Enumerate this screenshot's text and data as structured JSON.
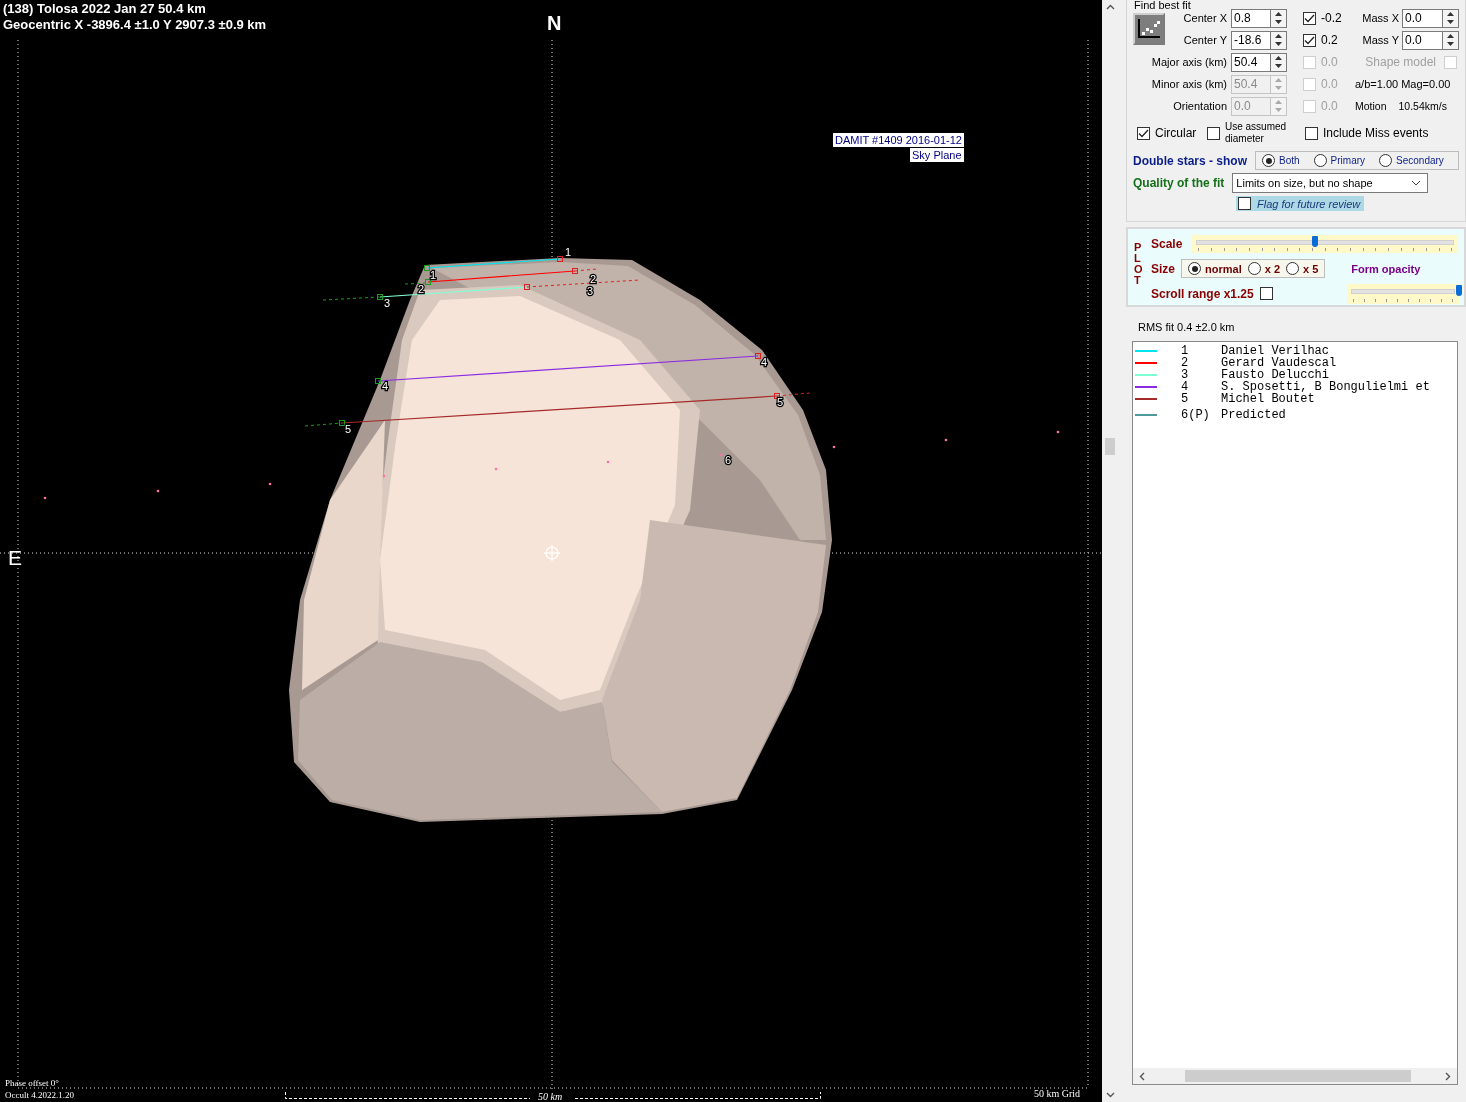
{
  "plot": {
    "title": "(138) Tolosa  2022 Jan 27   50.4 km",
    "subtitle": "Geocentric  X  -3896.4 ±1.0  Y 2907.3 ±0.9 km",
    "north": "N",
    "east": "E",
    "model_label": "DAMIT #1409 2016-01-12",
    "plane_label": "Sky Plane",
    "chords": [
      {
        "labels": [
          "1",
          "1"
        ]
      },
      {
        "labels": [
          "2",
          "2"
        ]
      },
      {
        "labels": [
          "3",
          "3"
        ]
      },
      {
        "labels": [
          "4",
          "4"
        ]
      },
      {
        "labels": [
          "5",
          "5"
        ]
      },
      {
        "labels": [
          "6"
        ]
      }
    ],
    "phase": "Phase offset 0°",
    "version": "Occult 4.2022.1.20",
    "scale_label": "50 km",
    "grid_label": "50 km Grid"
  },
  "fit": {
    "title": "Find best fit",
    "rows": [
      {
        "label": "Center X",
        "value": "0.8",
        "disabled": false,
        "check": {
          "label": "-0.2",
          "checked": true,
          "disabled": false
        }
      },
      {
        "label": "Center Y",
        "value": "-18.6",
        "disabled": false,
        "check": {
          "label": "0.2",
          "checked": true,
          "disabled": false
        }
      },
      {
        "label": "Major axis (km)",
        "value": "50.4",
        "disabled": false,
        "check": {
          "label": "0.0",
          "checked": false,
          "disabled": true
        }
      },
      {
        "label": "Minor axis (km)",
        "value": "50.4",
        "disabled": true,
        "check": {
          "label": "0.0",
          "checked": false,
          "disabled": true
        }
      },
      {
        "label": "Orientation",
        "value": "0.0",
        "disabled": true,
        "check": {
          "label": "0.0",
          "checked": false,
          "disabled": true
        }
      }
    ],
    "mass": [
      {
        "label": "Mass X",
        "value": "0.0"
      },
      {
        "label": "Mass Y",
        "value": "0.0"
      }
    ],
    "shape_model": {
      "label": "Shape model",
      "checked": false,
      "disabled": true
    },
    "ratio": "a/b=1.00  Mag=0.00",
    "motion_label": "Motion",
    "motion_value": "10.54km/s",
    "options": [
      {
        "label": "Circular",
        "checked": true
      },
      {
        "label": "Use assumed diameter",
        "checked": false
      },
      {
        "label": "Include Miss events",
        "checked": false
      }
    ]
  },
  "double_stars": {
    "label": "Double stars - show",
    "options": [
      {
        "label": "Both",
        "selected": true
      },
      {
        "label": "Primary",
        "selected": false
      },
      {
        "label": "Secondary",
        "selected": false
      }
    ]
  },
  "quality": {
    "label": "Quality of the fit",
    "value": "Limits on size, but no shape"
  },
  "flag": {
    "label": "Flag for future review",
    "checked": false
  },
  "plot_settings": {
    "title": "PLOT",
    "scale": {
      "label": "Scale",
      "level": 0.46
    },
    "size": {
      "label": "Size",
      "options": [
        {
          "label": "normal",
          "selected": true
        },
        {
          "label": "x 2",
          "selected": false
        },
        {
          "label": "x 5",
          "selected": false
        }
      ]
    },
    "opacity": {
      "label": "Form opacity",
      "level": 1.0
    },
    "scroll_range": {
      "label": "Scroll range x1.25",
      "checked": false
    }
  },
  "rms": "RMS fit 0.4 ±2.0 km",
  "observers": [
    {
      "number": "1",
      "name": "Daniel Verilhac",
      "color": "#00e5ee"
    },
    {
      "number": "2",
      "name": "Gerard Vaudescal",
      "color": "#ff0000"
    },
    {
      "number": "3",
      "name": "Fausto Delucchi",
      "color": "#7fffd4"
    },
    {
      "number": "4",
      "name": "S. Sposetti, B Bongulielmi et",
      "color": "#8a2be2"
    },
    {
      "number": "5",
      "name": "Michel Boutet",
      "color": "#a52a2a"
    },
    {
      "number": "6(P)",
      "name": "Predicted",
      "color": "#4f9a96"
    }
  ]
}
